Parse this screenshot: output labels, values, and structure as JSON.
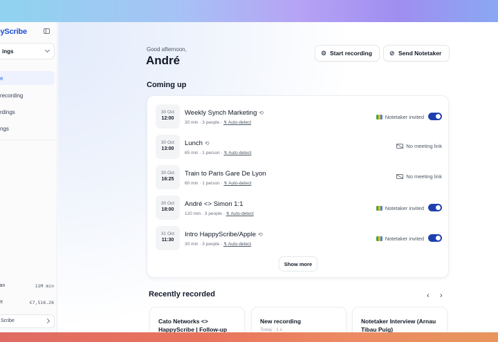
{
  "sidebar": {
    "logo": "pyScribe",
    "workspace": "ings",
    "nav": [
      {
        "label": "e",
        "active": true
      },
      {
        "label": "recording",
        "active": false
      },
      {
        "label": "rdings",
        "active": false
      },
      {
        "label": "ngs",
        "active": false
      }
    ],
    "stats": [
      {
        "key": "lan",
        "value": "11M min"
      },
      {
        "key": "et",
        "value": "€7,516.26"
      }
    ],
    "footer": "Scribe"
  },
  "header": {
    "greeting": "Good afternoon,",
    "name": "André",
    "start_recording": "Start recording",
    "send_notetaker": "Send Notetaker"
  },
  "coming_up": {
    "title": "Coming up",
    "events": [
      {
        "date": "30 Oct",
        "time": "12:00",
        "title": "Weekly Synch Marketing",
        "recurring": true,
        "meta": "30 min · 3 people · ",
        "auto": "Auto-detect",
        "status": "Notetaker invited",
        "has_meeting": true
      },
      {
        "date": "30 Oct",
        "time": "13:00",
        "title": "Lunch",
        "recurring": true,
        "meta": "65 min · 1 person · ",
        "auto": "Auto-detect",
        "status": "No meeting link",
        "has_meeting": false
      },
      {
        "date": "30 Oct",
        "time": "16:25",
        "title": "Train to Paris Gare De Lyon",
        "recurring": false,
        "meta": "60 min · 1 person · ",
        "auto": "Auto-detect",
        "status": "No meeting link",
        "has_meeting": false
      },
      {
        "date": "30 Oct",
        "time": "18:00",
        "title": "André <> Simon 1:1",
        "recurring": false,
        "meta": "120 min · 3 people · ",
        "auto": "Auto-detect",
        "status": "Notetaker invited",
        "has_meeting": true
      },
      {
        "date": "31 Oct",
        "time": "11:30",
        "title": "Intro HappyScribe/Apple",
        "recurring": true,
        "meta": "30 min · 3 people · ",
        "auto": "Auto-detect",
        "status": "Notetaker invited",
        "has_meeting": true
      }
    ],
    "show_more": "Show more"
  },
  "recently_recorded": {
    "title": "Recently recorded",
    "items": [
      {
        "title": "Cato Networks <> HappyScribe | Follow-up",
        "sub": ""
      },
      {
        "title": "New recording",
        "sub": "Today · 1 s"
      },
      {
        "title": "Notetaker Interview (Arnau Tibau Puig)",
        "sub": ""
      }
    ]
  }
}
